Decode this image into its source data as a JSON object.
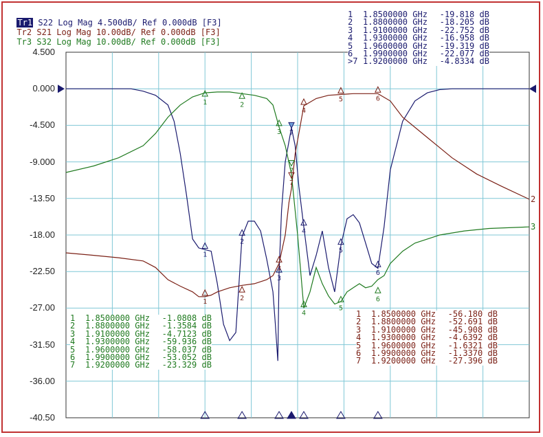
{
  "traces": [
    {
      "id": "Tr1",
      "label": "Tr1",
      "text": " S22 Log Mag 4.500dB/ Ref 0.000dB [F3]",
      "color": "#1a1a6e"
    },
    {
      "id": "Tr2",
      "label": "Tr2",
      "text": " S21 Log Mag 10.00dB/ Ref 0.000dB [F3]",
      "color": "#7a1f14"
    },
    {
      "id": "Tr3",
      "label": "Tr3",
      "text": " S32 Log Mag 10.00dB/ Ref 0.000dB [F3]",
      "color": "#1f7a1f"
    }
  ],
  "y_tick_labels": [
    "4.500",
    "0.000",
    "-4.500",
    "-9.000",
    "-13.50",
    "-18.00",
    "-22.50",
    "-27.00",
    "-31.50",
    "-36.00",
    "-40.50"
  ],
  "marker_tables": {
    "tr1": [
      {
        "n": "1",
        "freq": "1.8500000 GHz",
        "val": "-19.818 dB"
      },
      {
        "n": "2",
        "freq": "1.8800000 GHz",
        "val": "-18.205 dB"
      },
      {
        "n": "3",
        "freq": "1.9100000 GHz",
        "val": "-22.752 dB"
      },
      {
        "n": "4",
        "freq": "1.9300000 GHz",
        "val": "-16.958 dB"
      },
      {
        "n": "5",
        "freq": "1.9600000 GHz",
        "val": "-19.319 dB"
      },
      {
        "n": "6",
        "freq": "1.9900000 GHz",
        "val": "-22.077 dB"
      },
      {
        "n": ">7",
        "freq": "1.9200000 GHz",
        "val": "-4.8334 dB"
      }
    ],
    "tr3": [
      {
        "n": "1",
        "freq": "1.8500000 GHz",
        "val": "-1.0808 dB"
      },
      {
        "n": "2",
        "freq": "1.8800000 GHz",
        "val": "-1.3584 dB"
      },
      {
        "n": "3",
        "freq": "1.9100000 GHz",
        "val": "-4.7123 dB"
      },
      {
        "n": "4",
        "freq": "1.9300000 GHz",
        "val": "-59.936 dB"
      },
      {
        "n": "5",
        "freq": "1.9600000 GHz",
        "val": "-58.037 dB"
      },
      {
        "n": "6",
        "freq": "1.9900000 GHz",
        "val": "-53.052 dB"
      },
      {
        "n": "7",
        "freq": "1.9200000 GHz",
        "val": "-23.329 dB"
      }
    ],
    "tr2": [
      {
        "n": "1",
        "freq": "1.8500000 GHz",
        "val": "-56.180 dB"
      },
      {
        "n": "2",
        "freq": "1.8800000 GHz",
        "val": "-52.691 dB"
      },
      {
        "n": "3",
        "freq": "1.9100000 GHz",
        "val": "-45.908 dB"
      },
      {
        "n": "4",
        "freq": "1.9300000 GHz",
        "val": "-4.6392 dB"
      },
      {
        "n": "5",
        "freq": "1.9600000 GHz",
        "val": "-1.6321 dB"
      },
      {
        "n": "6",
        "freq": "1.9900000 GHz",
        "val": "-1.3370 dB"
      },
      {
        "n": "7",
        "freq": "1.9200000 GHz",
        "val": "-27.396 dB"
      }
    ]
  },
  "trace_end_labels": [
    "2",
    "3"
  ],
  "chart_data": {
    "type": "line",
    "x_unit": "GHz",
    "xlim": [
      1.7375,
      2.1125
    ],
    "ylim": [
      -40.5,
      4.5
    ],
    "grid": true,
    "grid_divisions": {
      "x": 10,
      "y": 10
    },
    "series": [
      {
        "name": "Tr1 S22",
        "color": "#1a1a6e",
        "x": [
          1.7375,
          1.79,
          1.8,
          1.81,
          1.82,
          1.825,
          1.83,
          1.835,
          1.84,
          1.845,
          1.85,
          1.855,
          1.86,
          1.865,
          1.87,
          1.875,
          1.88,
          1.885,
          1.89,
          1.895,
          1.9,
          1.905,
          1.907,
          1.909,
          1.91,
          1.912,
          1.915,
          1.92,
          1.923,
          1.926,
          1.93,
          1.935,
          1.94,
          1.945,
          1.95,
          1.955,
          1.96,
          1.965,
          1.97,
          1.975,
          1.98,
          1.985,
          1.99,
          1.995,
          2.0,
          2.01,
          2.02,
          2.03,
          2.04,
          2.05,
          2.1125
        ],
        "y": [
          0,
          0,
          -0.3,
          -0.8,
          -2,
          -4,
          -8,
          -13,
          -18.5,
          -19.6,
          -19.8,
          -20,
          -24,
          -29,
          -31,
          -30,
          -18.2,
          -16.3,
          -16.3,
          -17.5,
          -21,
          -25,
          -29,
          -33.5,
          -22.7,
          -15,
          -9,
          -4.8,
          -7,
          -12,
          -17,
          -23,
          -20.5,
          -17.5,
          -22,
          -25,
          -19.3,
          -16,
          -15.5,
          -16.5,
          -19,
          -21.5,
          -22.1,
          -17,
          -10,
          -4,
          -1.5,
          -0.5,
          -0.1,
          0,
          0
        ]
      },
      {
        "name": "Tr2 S21",
        "color": "#7a1f14",
        "x": [
          1.7375,
          1.76,
          1.78,
          1.8,
          1.81,
          1.82,
          1.83,
          1.84,
          1.845,
          1.85,
          1.855,
          1.86,
          1.87,
          1.88,
          1.89,
          1.9,
          1.905,
          1.91,
          1.915,
          1.918,
          1.92,
          1.923,
          1.926,
          1.93,
          1.94,
          1.95,
          1.96,
          1.97,
          1.98,
          1.99,
          2.0,
          2.01,
          2.03,
          2.05,
          2.07,
          2.09,
          2.1125
        ],
        "y": [
          -20.2,
          -20.5,
          -20.8,
          -21.2,
          -22,
          -23.5,
          -24.3,
          -25,
          -25.6,
          -25.6,
          -25.4,
          -25,
          -24.5,
          -24.2,
          -24,
          -23.5,
          -23,
          -21.5,
          -18,
          -14,
          -12.3,
          -8,
          -5.5,
          -2.1,
          -1.2,
          -0.8,
          -0.7,
          -0.6,
          -0.6,
          -0.6,
          -1.5,
          -3.5,
          -6,
          -8.5,
          -10.5,
          -12,
          -13.6
        ]
      },
      {
        "name": "Tr3 S32",
        "color": "#1f7a1f",
        "x": [
          1.7375,
          1.76,
          1.78,
          1.8,
          1.81,
          1.82,
          1.83,
          1.84,
          1.85,
          1.86,
          1.87,
          1.88,
          1.89,
          1.9,
          1.905,
          1.91,
          1.915,
          1.92,
          1.925,
          1.93,
          1.935,
          1.94,
          1.945,
          1.95,
          1.955,
          1.96,
          1.965,
          1.97,
          1.975,
          1.98,
          1.985,
          1.99,
          1.995,
          2.0,
          2.01,
          2.02,
          2.04,
          2.06,
          2.08,
          2.1125
        ],
        "y": [
          -10.3,
          -9.5,
          -8.5,
          -7,
          -5.5,
          -3.5,
          -2,
          -1,
          -0.5,
          -0.4,
          -0.4,
          -0.6,
          -0.8,
          -1.2,
          -2,
          -4.7,
          -7,
          -10.5,
          -18,
          -27,
          -25,
          -22,
          -24,
          -25.5,
          -26.5,
          -26.2,
          -25,
          -24.5,
          -24,
          -24.5,
          -24.3,
          -23.5,
          -23,
          -21.5,
          -20,
          -19,
          -18,
          -17.5,
          -17.2,
          -17
        ]
      }
    ],
    "markers": {
      "Tr1": [
        {
          "n": "1",
          "x": 1.85,
          "y": -19.818
        },
        {
          "n": "2",
          "x": 1.88,
          "y": -18.205
        },
        {
          "n": "3",
          "x": 1.91,
          "y": -22.752
        },
        {
          "n": "4",
          "x": 1.93,
          "y": -16.958
        },
        {
          "n": "5",
          "x": 1.96,
          "y": -19.319
        },
        {
          "n": "6",
          "x": 1.99,
          "y": -22.077
        },
        {
          "n": "7",
          "x": 1.92,
          "y": -4.8334
        }
      ],
      "Tr3": [
        {
          "n": "1",
          "x": 1.85,
          "y": -1.0808
        },
        {
          "n": "2",
          "x": 1.88,
          "y": -1.3584
        },
        {
          "n": "3",
          "x": 1.91,
          "y": -4.7123
        },
        {
          "n": "4",
          "x": 1.93,
          "y": -27.0
        },
        {
          "n": "5",
          "x": 1.96,
          "y": -26.4
        },
        {
          "n": "6",
          "x": 1.99,
          "y": -25.3
        },
        {
          "n": "7",
          "x": 1.92,
          "y": -9.5
        }
      ],
      "Tr2": [
        {
          "n": "1",
          "x": 1.85,
          "y": -25.6
        },
        {
          "n": "2",
          "x": 1.88,
          "y": -25.2
        },
        {
          "n": "3",
          "x": 1.91,
          "y": -21.5
        },
        {
          "n": "4",
          "x": 1.93,
          "y": -2.1
        },
        {
          "n": "5",
          "x": 1.96,
          "y": -0.7
        },
        {
          "n": "6",
          "x": 1.99,
          "y": -0.6
        },
        {
          "n": "7",
          "x": 1.92,
          "y": -11.0
        }
      ]
    }
  }
}
